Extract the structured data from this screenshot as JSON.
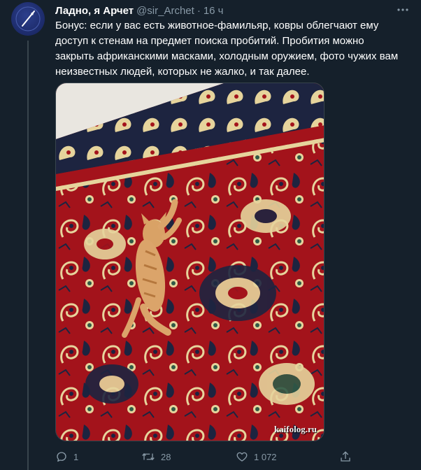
{
  "tweet": {
    "display_name": "Ладно, я Арчет",
    "handle": "@sir_Archet",
    "separator": "·",
    "time": "16 ч",
    "text": "Бонус: если у вас есть животное-фамильяр, ковры облегчают ему\nдоступ к стенам на предмет поиска пробитий. Пробития можно\nзакрыть африканскими масками, холодным оружием, фото чужих вам\nнеизвестных людей, которых не жалко, и так далее.",
    "media": {
      "watermark": "kaifolog.ru",
      "description_icon": "photo"
    }
  },
  "actions": {
    "reply": {
      "icon": "reply-icon",
      "count": "1"
    },
    "retweet": {
      "icon": "retweet-icon",
      "count": "28"
    },
    "like": {
      "icon": "heart-icon",
      "count": "1 072"
    },
    "share": {
      "icon": "share-icon"
    }
  },
  "colors": {
    "background": "#15202b",
    "text_primary": "#ffffff",
    "text_secondary": "#8899a6",
    "border": "#38444d",
    "carpet_red": "#a8141b",
    "carpet_cream": "#e8d9a6"
  }
}
